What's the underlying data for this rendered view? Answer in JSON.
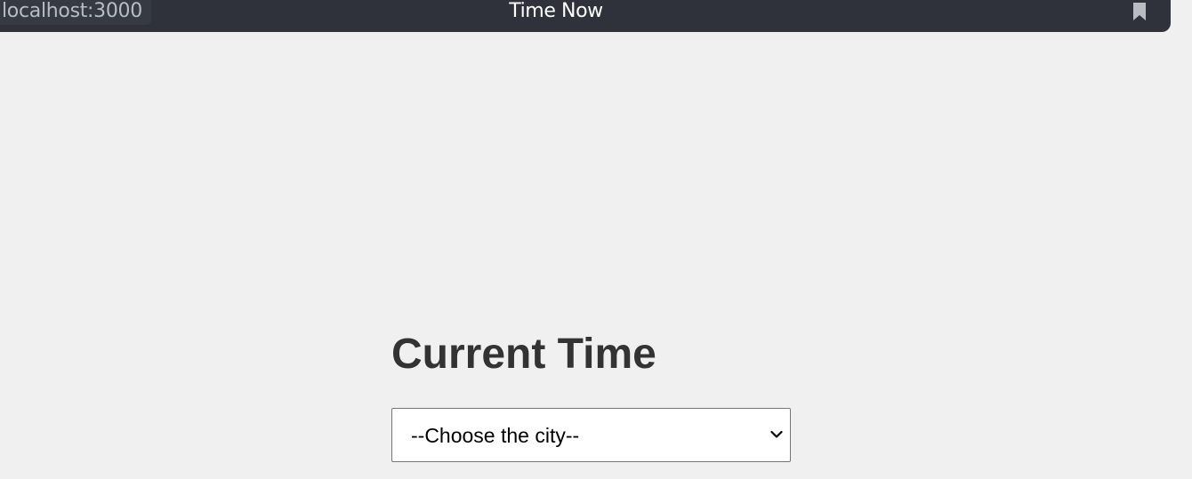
{
  "browser": {
    "url": "localhost:3000",
    "tab_title": "Time Now",
    "bookmark_icon": "bookmark-icon"
  },
  "page": {
    "heading": "Current Time",
    "city_select": {
      "selected": "--Choose the city--",
      "icon": "chevron-down-icon"
    }
  },
  "colors": {
    "browser_bar": "#2f323a",
    "page_background": "#f0f0f0",
    "heading_text": "#333333"
  }
}
